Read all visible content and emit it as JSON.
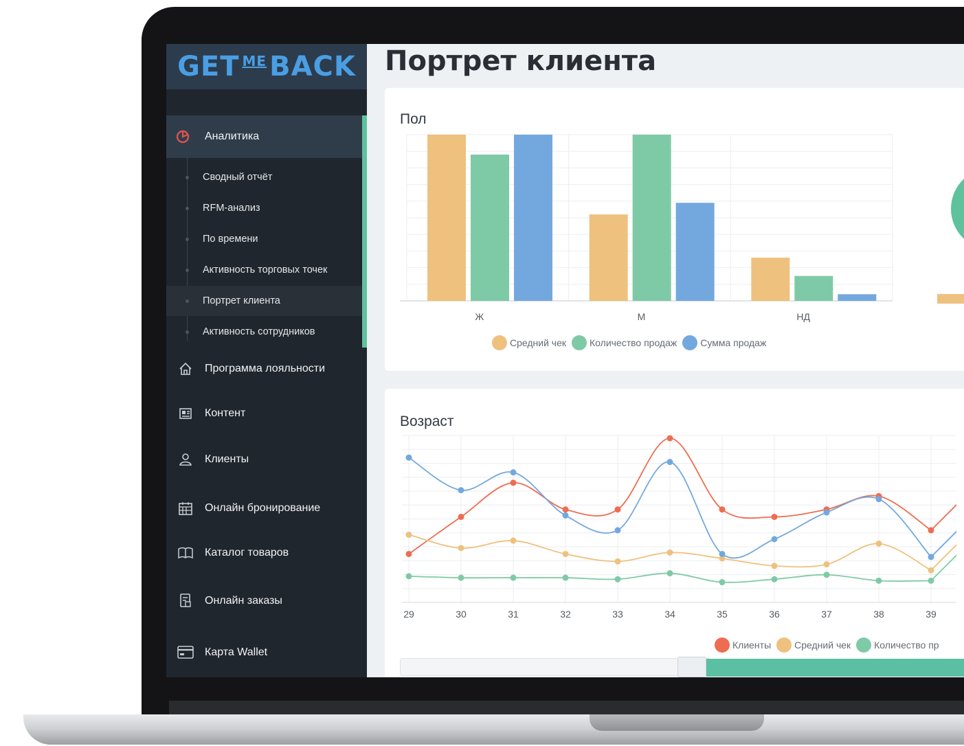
{
  "brand": {
    "logo_left": "GET",
    "logo_middle": "ME",
    "logo_right": "BACK",
    "logo_color": "#4a9ee3"
  },
  "sidebar": {
    "active_section": {
      "label": "Аналитика",
      "icon": "analytics-icon"
    },
    "sub_items": [
      {
        "label": "Сводный отчёт"
      },
      {
        "label": "RFM-анализ"
      },
      {
        "label": "По времени"
      },
      {
        "label": "Активность торговых точек"
      },
      {
        "label": "Портрет клиента",
        "selected": true
      },
      {
        "label": "Активность сотрудников"
      }
    ],
    "items": [
      {
        "label": "Программа лояльности",
        "icon": "home-icon"
      },
      {
        "label": "Контент",
        "icon": "content-icon"
      },
      {
        "label": "Клиенты",
        "icon": "user-icon"
      },
      {
        "label": "Онлайн бронирование",
        "icon": "calendar-icon"
      },
      {
        "label": "Каталог товаров",
        "icon": "book-icon"
      },
      {
        "label": "Онлайн заказы",
        "icon": "order-icon"
      },
      {
        "label": "Карта Wallet",
        "icon": "card-icon"
      }
    ],
    "accent_color": "#5ec29c"
  },
  "main": {
    "title": "Портрет клиента"
  },
  "colors": {
    "orange": "#eec17f",
    "green": "#7fcaa6",
    "blue": "#73a8df",
    "red": "#ee6d52"
  },
  "chart_data": [
    {
      "type": "bar",
      "title": "Пол",
      "categories": [
        "Ж",
        "М",
        "НД"
      ],
      "ylim": [
        0,
        100
      ],
      "series": [
        {
          "name": "Средний чек",
          "color": "#eec17f",
          "values": [
            100,
            52,
            26
          ]
        },
        {
          "name": "Количество продаж",
          "color": "#7fcaa6",
          "values": [
            88,
            100,
            15
          ]
        },
        {
          "name": "Сумма продаж",
          "color": "#73a8df",
          "values": [
            100,
            59,
            4
          ]
        }
      ],
      "grid": true,
      "legend": "bottom"
    },
    {
      "type": "line",
      "title": "Возраст",
      "x": [
        "29",
        "30",
        "31",
        "32",
        "33",
        "34",
        "35",
        "36",
        "37",
        "38",
        "39"
      ],
      "ylim": [
        0,
        100
      ],
      "series": [
        {
          "name": "Клиенты",
          "color": "#ee6d52",
          "values": [
            22,
            47,
            70,
            52,
            52,
            100,
            52,
            47,
            52,
            61,
            38
          ]
        },
        {
          "name": "Средний чек",
          "color": "#eec17f",
          "values": [
            35,
            26,
            31,
            22,
            17,
            23,
            19,
            14,
            15,
            29,
            11
          ]
        },
        {
          "name": "Количество продаж",
          "color": "#7fcaa6",
          "values": [
            7,
            6,
            6,
            6,
            5,
            9,
            3,
            5,
            8,
            4,
            4
          ]
        },
        {
          "name": "",
          "color": "#73a8df",
          "values": [
            87,
            65,
            77,
            48,
            38,
            84,
            22,
            32,
            50,
            59,
            20
          ]
        }
      ],
      "legend_labels": [
        "Клиенты",
        "Средний чек",
        "Количество пр"
      ],
      "grid": true,
      "legend": "bottom"
    }
  ]
}
